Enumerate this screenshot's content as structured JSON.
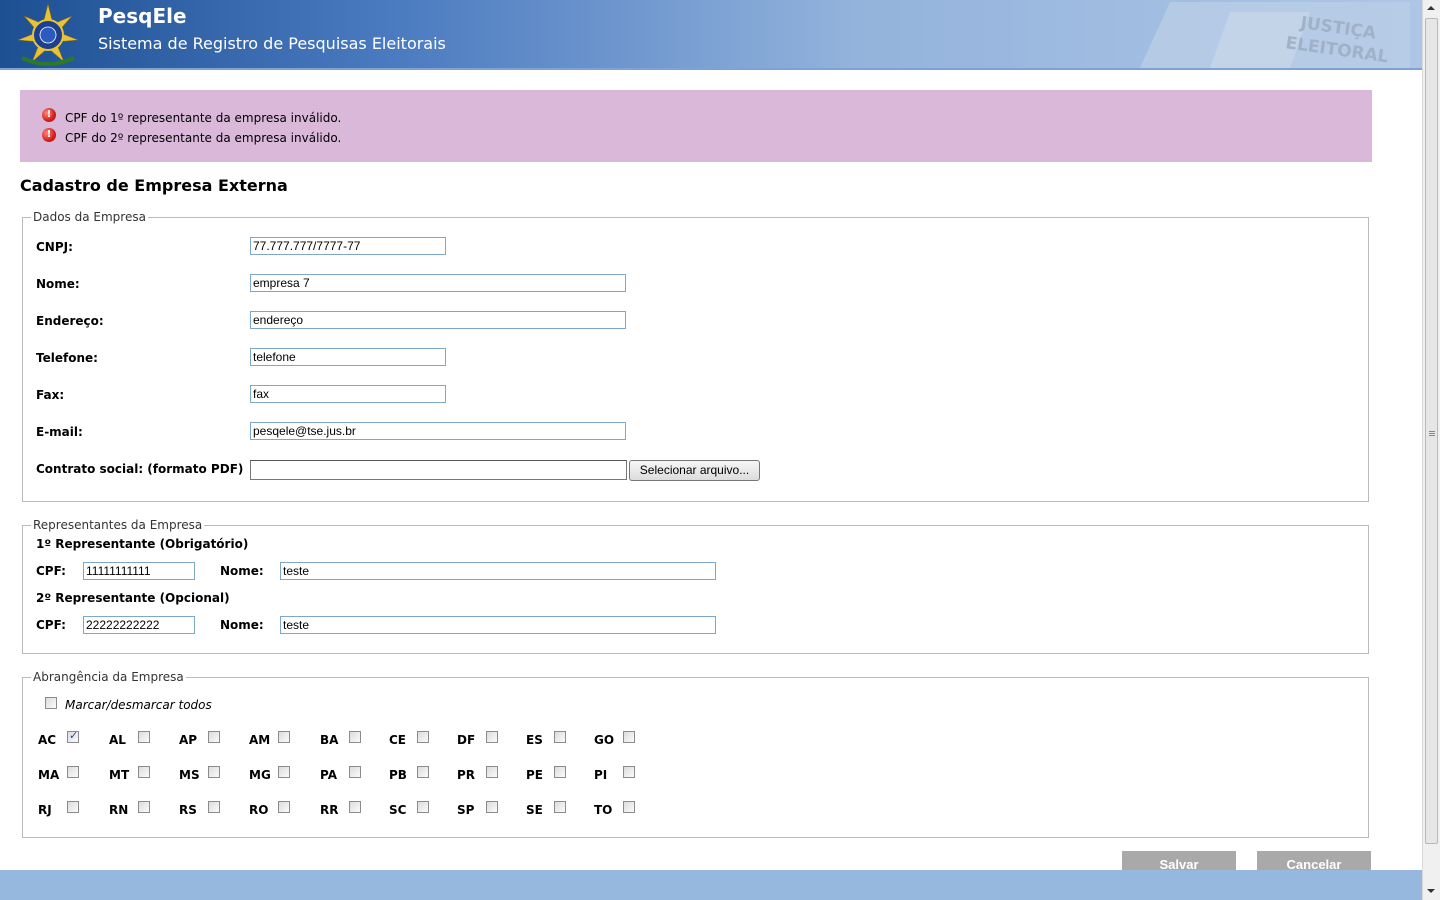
{
  "header": {
    "app_name": "PesqEle",
    "app_subtitle": "Sistema de Registro de Pesquisas Eleitorais",
    "stamp_text": "JUSTIÇA ELEITORAL"
  },
  "messages": [
    {
      "text": "CPF do 1º representante da empresa inválido.",
      "icon": "error-icon"
    },
    {
      "text": "CPF do 2º representante da empresa inválido.",
      "icon": "error-icon"
    }
  ],
  "page_title": "Cadastro de Empresa Externa",
  "dados": {
    "legend": "Dados da Empresa",
    "fields": {
      "cnpj": {
        "label": "CNPJ:",
        "value": "77.777.777/7777-77"
      },
      "nome": {
        "label": "Nome:",
        "value": "empresa 7"
      },
      "endereco": {
        "label": "Endereço:",
        "value": "endereço"
      },
      "telefone": {
        "label": "Telefone:",
        "value": "telefone"
      },
      "fax": {
        "label": "Fax:",
        "value": "fax"
      },
      "email": {
        "label": "E-mail:",
        "value": "pesqele@tse.jus.br"
      },
      "contrato": {
        "label": "Contrato social: (formato PDF)",
        "value": "",
        "button": "Selecionar arquivo..."
      }
    }
  },
  "representantes": {
    "legend": "Representantes da Empresa",
    "rep1": {
      "title": "1º Representante (Obrigatório)",
      "cpf_label": "CPF:",
      "cpf": "11111111111",
      "nome_label": "Nome:",
      "nome": "teste"
    },
    "rep2": {
      "title": "2º Representante (Opcional)",
      "cpf_label": "CPF:",
      "cpf": "22222222222",
      "nome_label": "Nome:",
      "nome": "teste"
    }
  },
  "abrangencia": {
    "legend": "Abrangência da Empresa",
    "toggle_all": "Marcar/desmarcar todos",
    "states": [
      {
        "uf": "AC",
        "checked": true
      },
      {
        "uf": "AL",
        "checked": false
      },
      {
        "uf": "AP",
        "checked": false
      },
      {
        "uf": "AM",
        "checked": false
      },
      {
        "uf": "BA",
        "checked": false
      },
      {
        "uf": "CE",
        "checked": false
      },
      {
        "uf": "DF",
        "checked": false
      },
      {
        "uf": "ES",
        "checked": false
      },
      {
        "uf": "GO",
        "checked": false
      },
      {
        "uf": "MA",
        "checked": false
      },
      {
        "uf": "MT",
        "checked": false
      },
      {
        "uf": "MS",
        "checked": false
      },
      {
        "uf": "MG",
        "checked": false
      },
      {
        "uf": "PA",
        "checked": false
      },
      {
        "uf": "PB",
        "checked": false
      },
      {
        "uf": "PR",
        "checked": false
      },
      {
        "uf": "PE",
        "checked": false
      },
      {
        "uf": "PI",
        "checked": false
      },
      {
        "uf": "RJ",
        "checked": false
      },
      {
        "uf": "RN",
        "checked": false
      },
      {
        "uf": "RS",
        "checked": false
      },
      {
        "uf": "RO",
        "checked": false
      },
      {
        "uf": "RR",
        "checked": false
      },
      {
        "uf": "SC",
        "checked": false
      },
      {
        "uf": "SP",
        "checked": false
      },
      {
        "uf": "SE",
        "checked": false
      },
      {
        "uf": "TO",
        "checked": false
      }
    ]
  },
  "actions": {
    "save": "Salvar",
    "cancel": "Cancelar"
  },
  "colors": {
    "header": "#4b7bc0",
    "message_bg": "#dab8da",
    "footer": "#96b8de",
    "button_disabled": "#a9a9a9"
  }
}
